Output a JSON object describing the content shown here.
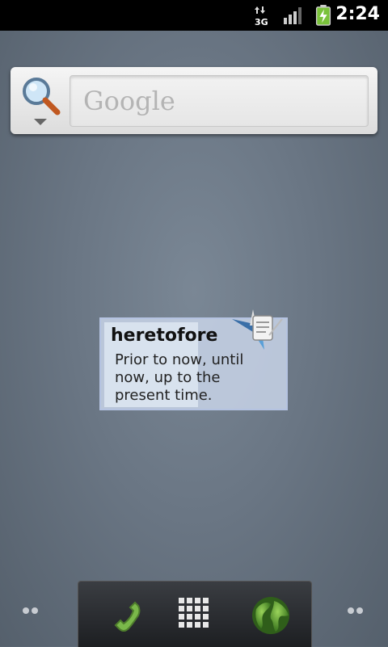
{
  "status_bar": {
    "network_type": "3G",
    "time": "2:24",
    "icons": [
      "data-arrows-icon",
      "signal-icon",
      "battery-charging-icon"
    ]
  },
  "search_widget": {
    "placeholder": "Google",
    "icons": [
      "search-magnifier-icon",
      "dropdown-arrow-icon"
    ]
  },
  "dictionary_widget": {
    "word": "heretofore",
    "definition": "Prior to now, until now, up to the present time.",
    "icon": "dictionary-logo-icon"
  },
  "dock": {
    "items": [
      {
        "name": "phone",
        "icon": "phone-icon"
      },
      {
        "name": "apps",
        "icon": "app-drawer-icon"
      },
      {
        "name": "browser",
        "icon": "globe-icon"
      }
    ]
  },
  "colors": {
    "status_bar_bg": "#000000",
    "battery_green": "#7ac23a",
    "wallpaper": "#6a7684"
  }
}
